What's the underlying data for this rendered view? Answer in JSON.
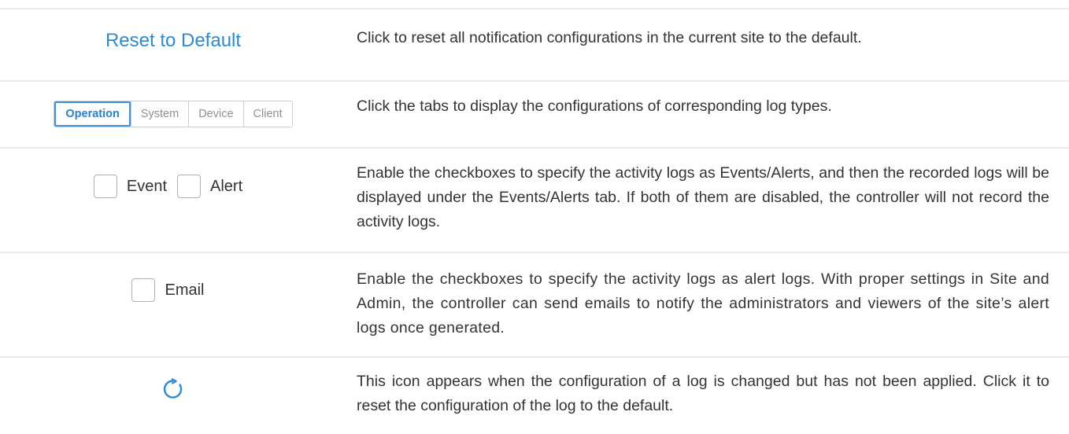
{
  "rows": [
    {
      "control_label": "Reset to Default",
      "description": "Click to reset all notification configurations in the current site to the default."
    },
    {
      "tabs": [
        {
          "label": "Operation",
          "active": true
        },
        {
          "label": "System",
          "active": false
        },
        {
          "label": "Device",
          "active": false
        },
        {
          "label": "Client",
          "active": false
        }
      ],
      "description": "Click the tabs to display the configurations of corresponding log types."
    },
    {
      "checkboxes": [
        "Event",
        "Alert"
      ],
      "description": "Enable the checkboxes to specify the activity logs as Events/Alerts, and then the recorded logs will be displayed under the Events/Alerts tab. If both of them are disabled, the controller will not record the activity logs."
    },
    {
      "checkboxes": [
        "Email"
      ],
      "description": "Enable the checkboxes to specify the activity logs as alert logs. With proper settings in Site and Admin, the controller can send emails to notify the administrators and viewers of the site’s alert logs once generated."
    },
    {
      "icon": "refresh-icon",
      "description": "This icon appears when the configuration of a log is changed but has not been applied. Click it to reset the configuration of the log to the default."
    }
  ],
  "colors": {
    "accent": "#2c89d4",
    "divider": "#e6ebf1",
    "text": "#333333"
  }
}
